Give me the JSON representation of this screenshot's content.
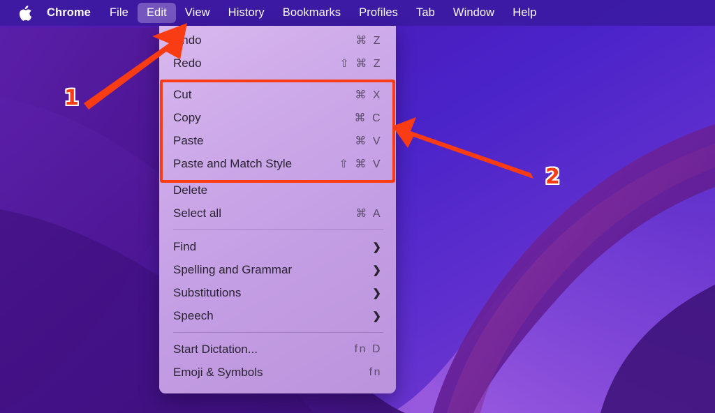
{
  "menubar": {
    "apple_icon": "apple-logo-icon",
    "items": [
      {
        "label": "Chrome",
        "bold": true,
        "active": false
      },
      {
        "label": "File",
        "bold": false,
        "active": false
      },
      {
        "label": "Edit",
        "bold": false,
        "active": true
      },
      {
        "label": "View",
        "bold": false,
        "active": false
      },
      {
        "label": "History",
        "bold": false,
        "active": false
      },
      {
        "label": "Bookmarks",
        "bold": false,
        "active": false
      },
      {
        "label": "Profiles",
        "bold": false,
        "active": false
      },
      {
        "label": "Tab",
        "bold": false,
        "active": false
      },
      {
        "label": "Window",
        "bold": false,
        "active": false
      },
      {
        "label": "Help",
        "bold": false,
        "active": false
      }
    ]
  },
  "edit_menu": {
    "title": "Edit",
    "items": [
      {
        "label": "Undo",
        "shortcut": "⌘ Z",
        "submenu": false
      },
      {
        "label": "Redo",
        "shortcut": "⇧ ⌘ Z",
        "submenu": false
      },
      {
        "separator": true
      },
      {
        "label": "Cut",
        "shortcut": "⌘ X",
        "submenu": false
      },
      {
        "label": "Copy",
        "shortcut": "⌘ C",
        "submenu": false
      },
      {
        "label": "Paste",
        "shortcut": "⌘ V",
        "submenu": false
      },
      {
        "label": "Paste and Match Style",
        "shortcut": "⇧ ⌘ V",
        "submenu": false
      },
      {
        "label": "Delete",
        "shortcut": "",
        "submenu": false
      },
      {
        "label": "Select all",
        "shortcut": "⌘ A",
        "submenu": false
      },
      {
        "separator": true
      },
      {
        "label": "Find",
        "shortcut": "",
        "submenu": true
      },
      {
        "label": "Spelling and Grammar",
        "shortcut": "",
        "submenu": true
      },
      {
        "label": "Substitutions",
        "shortcut": "",
        "submenu": true
      },
      {
        "label": "Speech",
        "shortcut": "",
        "submenu": true
      },
      {
        "separator": true
      },
      {
        "label": "Start Dictation...",
        "shortcut": "fn D",
        "submenu": false
      },
      {
        "label": "Emoji & Symbols",
        "shortcut": "fn",
        "submenu": false
      }
    ],
    "submenu_glyph": "❯"
  },
  "annotations": {
    "accent_color": "#f93c13",
    "markers": [
      {
        "number": "1",
        "target": "edit-menubar-item"
      },
      {
        "number": "2",
        "target": "clipboard-commands-group"
      }
    ],
    "highlight_box": {
      "label": "clipboard-commands-group"
    }
  },
  "colors": {
    "menubar_bg": "#3a1aa0",
    "menu_panel": "#c9a4e6",
    "annotation_red": "#f93c13",
    "wallpaper_dark": "#3d1180",
    "wallpaper_light": "#8b4bd8"
  }
}
